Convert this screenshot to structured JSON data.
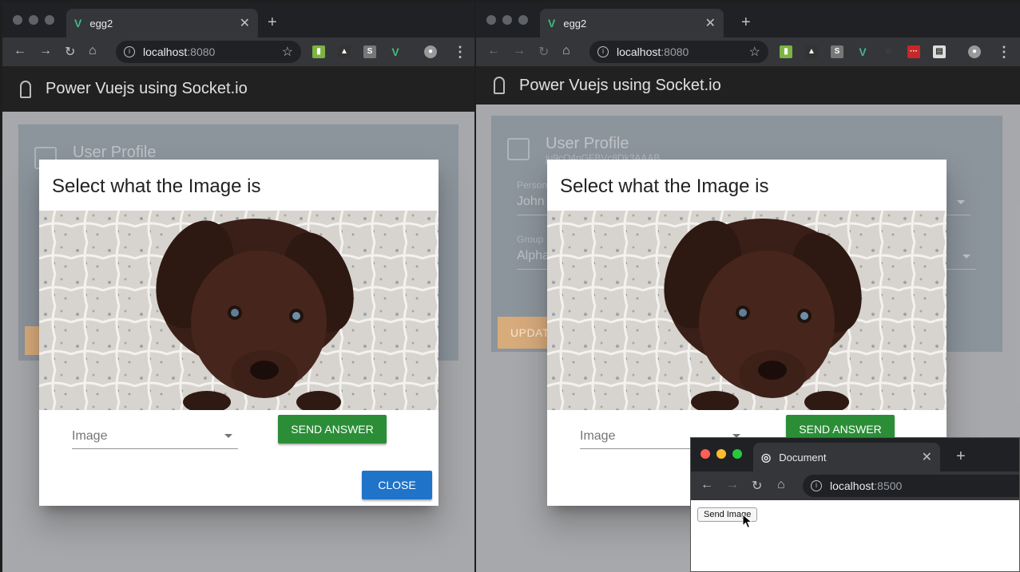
{
  "left_browser": {
    "tab_title": "egg2",
    "url_host": "localhost",
    "url_port": ":8080"
  },
  "right_browser": {
    "tab_title": "egg2",
    "url_host": "localhost",
    "url_port": ":8080"
  },
  "app": {
    "title": "Power Vuejs using Socket.io",
    "card_title": "User Profile",
    "card_subtitle": "ju9cO4nGFBVc8Dk3AAAB",
    "person_label": "Person",
    "person_value": "John",
    "group_label": "Group",
    "group_value": "Alpha",
    "update_button": "UPDATE"
  },
  "dialog": {
    "title": "Select what the Image is",
    "select_label": "Image",
    "send_answer": "SEND ANSWER",
    "close": "CLOSE"
  },
  "small_browser": {
    "tab_title": "Document",
    "url_host": "localhost",
    "url_port": ":8500",
    "send_image_button": "Send Image"
  },
  "colors": {
    "accent_green": "#2b8e37",
    "accent_blue": "#1f73c9",
    "vue_green": "#41b883"
  }
}
